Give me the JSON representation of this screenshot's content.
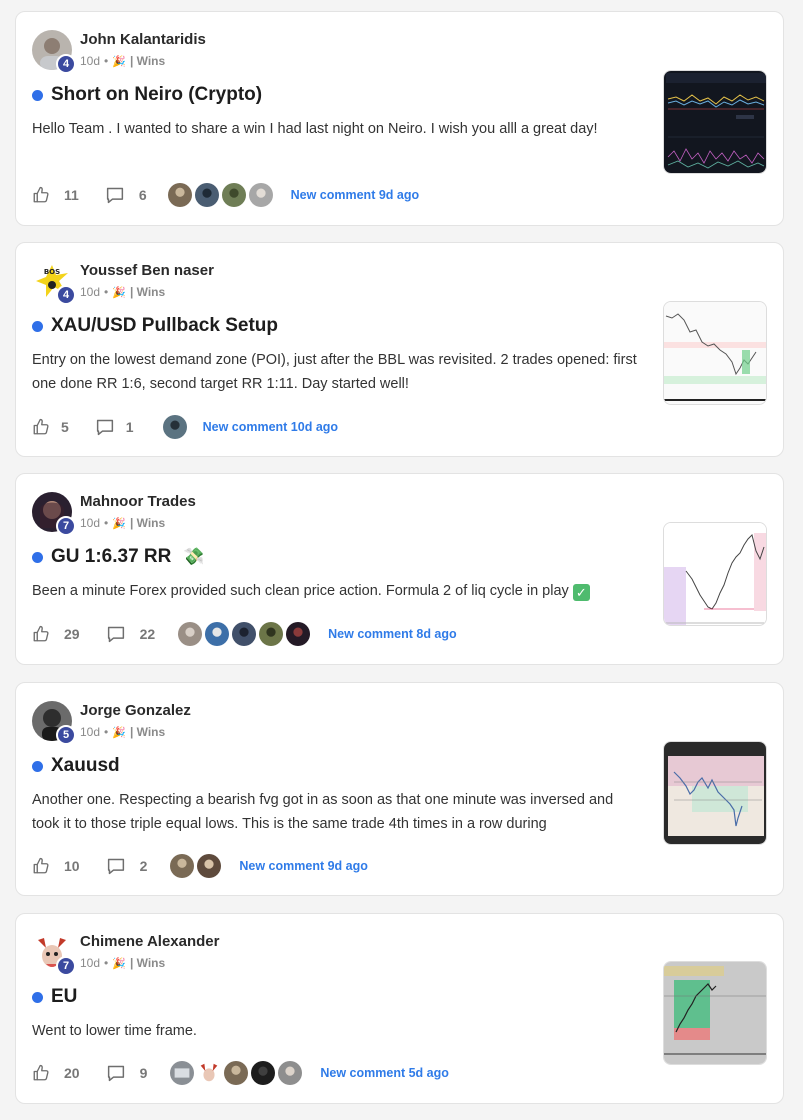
{
  "posts": [
    {
      "author": "John Kalantaridis",
      "level": "4",
      "time": "10d",
      "separator": "•",
      "category": "| Wins",
      "title": "Short on Neiro (Crypto)",
      "title_emoji": "",
      "body": "Hello Team . I wanted to share a win I had last night on Neiro. I wish you alll a great day!",
      "likes": "11",
      "comments": "6",
      "new_comment": "New comment 9d ago"
    },
    {
      "author": "Youssef Ben naser",
      "level": "4",
      "time": "10d",
      "separator": "•",
      "category": "| Wins",
      "title": "XAU/USD Pullback Setup",
      "title_emoji": "",
      "body": "Entry on the lowest demand zone (POI), just after the BBL was revisited. 2 trades opened: first one done RR 1:6, second target RR 1:11. Day started well!",
      "likes": "5",
      "comments": "1",
      "new_comment": "New comment 10d ago"
    },
    {
      "author": "Mahnoor Trades",
      "level": "7",
      "time": "10d",
      "separator": "•",
      "category": "| Wins",
      "title": "GU 1:6.37 RR",
      "title_emoji": "💸",
      "body": "Been a minute Forex provided such clean price action. Formula 2 of liq cycle in play",
      "body_emoji": "✓",
      "likes": "29",
      "comments": "22",
      "new_comment": "New comment 8d ago"
    },
    {
      "author": "Jorge Gonzalez",
      "level": "5",
      "time": "10d",
      "separator": "•",
      "category": "| Wins",
      "title": "Xauusd",
      "title_emoji": "",
      "body": "Another one. Respecting a bearish fvg got in as soon as that one minute was inversed and took it to those triple equal lows. This is the same trade 4th times in a row during",
      "likes": "10",
      "comments": "2",
      "new_comment": "New comment 9d ago"
    },
    {
      "author": "Chimene Alexander",
      "level": "7",
      "time": "10d",
      "separator": "•",
      "category": "| Wins",
      "title": "EU",
      "title_emoji": "",
      "body": "Went to lower time frame.",
      "likes": "20",
      "comments": "9",
      "new_comment": "New comment 5d ago"
    }
  ],
  "icons": {
    "like": "thumbs-up-icon",
    "comment": "comment-bubble-icon",
    "party": "party-popper-icon"
  },
  "colors": {
    "accent_dot": "#2f6fe8",
    "new_comment": "#2f7be8",
    "level_badge": "#3b4a9f"
  }
}
